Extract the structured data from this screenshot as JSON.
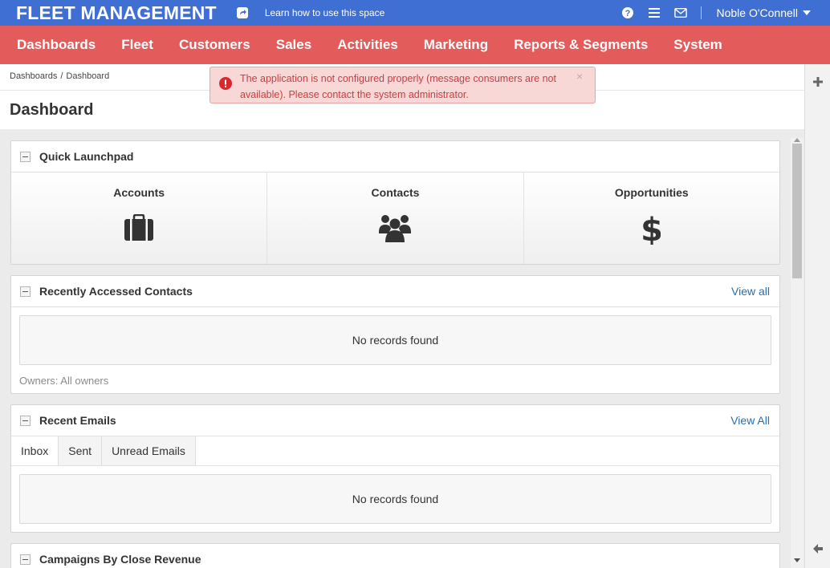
{
  "topbar": {
    "app_title": "FLEET MANAGEMENT",
    "learn_link": "Learn how to use this space",
    "user_name": "Noble O'Connell",
    "bg_color": "#3f6fd3"
  },
  "menu": {
    "bg_color": "#e45b5b",
    "items": [
      {
        "label": "Dashboards"
      },
      {
        "label": "Fleet"
      },
      {
        "label": "Customers"
      },
      {
        "label": "Sales"
      },
      {
        "label": "Activities"
      },
      {
        "label": "Marketing"
      },
      {
        "label": "Reports & Segments"
      },
      {
        "label": "System"
      }
    ]
  },
  "breadcrumb": {
    "items": [
      "Dashboards",
      "Dashboard"
    ],
    "separator": "/"
  },
  "page": {
    "title": "Dashboard"
  },
  "alert": {
    "message": "The application is not configured properly (message consumers are not available). Please contact the system administrator.",
    "close": "×"
  },
  "quick_launchpad": {
    "title": "Quick Launchpad",
    "items": [
      {
        "label": "Accounts",
        "icon": "briefcase-icon"
      },
      {
        "label": "Contacts",
        "icon": "users-icon"
      },
      {
        "label": "Opportunities",
        "icon": "dollar-icon"
      }
    ]
  },
  "recent_contacts": {
    "title": "Recently Accessed Contacts",
    "view_all": "View all",
    "empty": "No records found",
    "owners": "Owners: All owners"
  },
  "recent_emails": {
    "title": "Recent Emails",
    "view_all": "View All",
    "tabs": [
      "Inbox",
      "Sent",
      "Unread Emails"
    ],
    "active_tab": "Inbox",
    "empty": "No records found"
  },
  "campaigns": {
    "title": "Campaigns By Close Revenue"
  }
}
